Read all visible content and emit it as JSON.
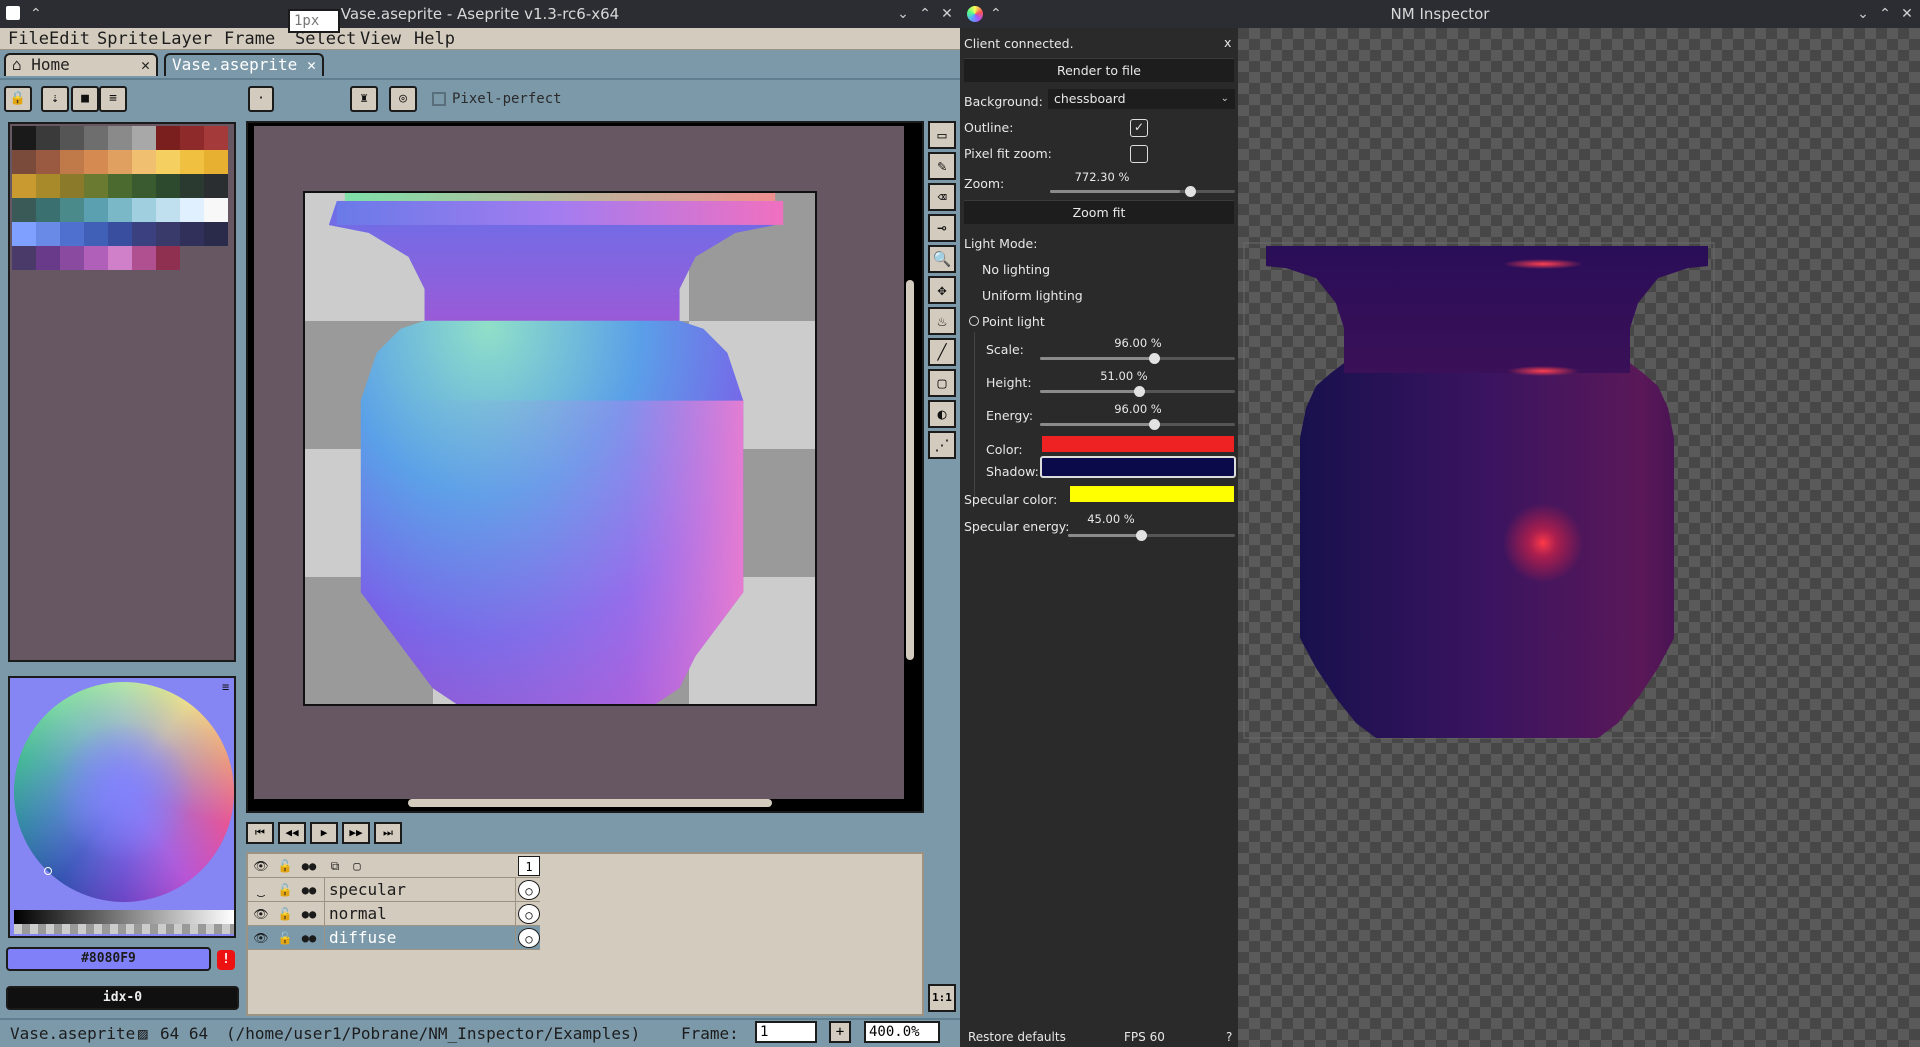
{
  "aseprite": {
    "title": "Vase.aseprite - Aseprite v1.3-rc6-x64",
    "menu": [
      "File",
      "Edit",
      "Sprite",
      "Layer",
      "Frame",
      "Select",
      "View",
      "Help"
    ],
    "tabs": [
      {
        "label": "Home",
        "close": "✕"
      },
      {
        "label": "Vase.aseprite",
        "close": "✕"
      }
    ],
    "context_bar": {
      "brush_size": "1px",
      "pixel_perfect": "Pixel-perfect"
    },
    "palette_colors": [
      "#1a1a1a",
      "#3a3a3a",
      "#555555",
      "#6e6e6e",
      "#8a8a8a",
      "#a8a8a8",
      "#7a1e1e",
      "#8e2a2a",
      "#a53a3a",
      "#7a4a3a",
      "#9a5a42",
      "#c07a4a",
      "#d48a50",
      "#e0a060",
      "#f0c070",
      "#f5d060",
      "#f0c040",
      "#e8b030",
      "#c89a30",
      "#a88a2a",
      "#8a7a2a",
      "#6a7a30",
      "#4a6a30",
      "#3a5a30",
      "#2e4a2e",
      "#2a3a30",
      "#2a2e30",
      "#3a5a58",
      "#3a7070",
      "#4a8a8a",
      "#5aa0b0",
      "#7ab8c8",
      "#a0d0e0",
      "#c0e0f0",
      "#e0f0ff",
      "#f8f8f8",
      "#80a0ff",
      "#6a8ae8",
      "#5070d0",
      "#4060b8",
      "#3a4ea0",
      "#3a4080",
      "#3a3a6a",
      "#30305a",
      "#2a2a4a",
      "#4a3a6a",
      "#6a3a8a",
      "#8a4aa0",
      "#b060b8",
      "#d080c8",
      "#b05090",
      "#903050"
    ],
    "fg_color": "#8080F9",
    "bg_color": "idx-0",
    "tools": [
      "▭",
      "✎",
      "⌫",
      "⊸",
      "🔍",
      "✥",
      "♨",
      "╱",
      "▢",
      "◐",
      "⋰"
    ],
    "playback": [
      "⏮",
      "◀◀",
      "▶",
      "▶▶",
      "⏭"
    ],
    "timeline": {
      "frame_header": "1",
      "layers": [
        {
          "name": "specular",
          "visible_icon": "‿",
          "lock_icon": "🔓",
          "link_icon": "●●",
          "cel": "○"
        },
        {
          "name": "normal",
          "visible_icon": "👁",
          "lock_icon": "🔓",
          "link_icon": "●●",
          "cel": "○"
        },
        {
          "name": "diffuse",
          "visible_icon": "👁",
          "lock_icon": "🔓",
          "link_icon": "●●",
          "cel": "○"
        }
      ]
    },
    "status": {
      "file": "Vase.aseprite",
      "size": "64 64",
      "path": "(/home/user1/Pobrane/NM_Inspector/Examples)",
      "frame_label": "Frame:",
      "frame_value": "1",
      "frame_add": "+",
      "zoom": "400.0%",
      "zoom11": "1:1"
    },
    "accent": "#7c99aa"
  },
  "inspector": {
    "title": "NM Inspector",
    "client_status": "Client connected.",
    "close_label": "x",
    "render_button": "Render to file",
    "background_label": "Background:",
    "background_value": "chessboard",
    "outline_label": "Outline:",
    "outline_checked": "✓",
    "pixel_fit_label": "Pixel fit zoom:",
    "zoom_label": "Zoom:",
    "zoom_value": "772.30 %",
    "zoom_fraction": 0.772,
    "zoom_fit_button": "Zoom fit",
    "light_mode_label": "Light Mode:",
    "light_modes": [
      "No lighting",
      "Uniform lighting",
      "Point light"
    ],
    "scale_label": "Scale:",
    "scale_value": "96.00 %",
    "height_label": "Height:",
    "height_value": "51.00 %",
    "energy_label": "Energy:",
    "energy_value": "96.00 %",
    "color_label": "Color:",
    "light_color": "#ee2222",
    "shadow_label": "Shadow:",
    "shadow_color": "#0a0a4a",
    "specular_color_label": "Specular color:",
    "specular_color": "#ffff00",
    "specular_energy_label": "Specular energy:",
    "specular_energy_value": "45.00 %",
    "restore_button": "Restore defaults",
    "fps": "FPS 60",
    "help": "?"
  }
}
